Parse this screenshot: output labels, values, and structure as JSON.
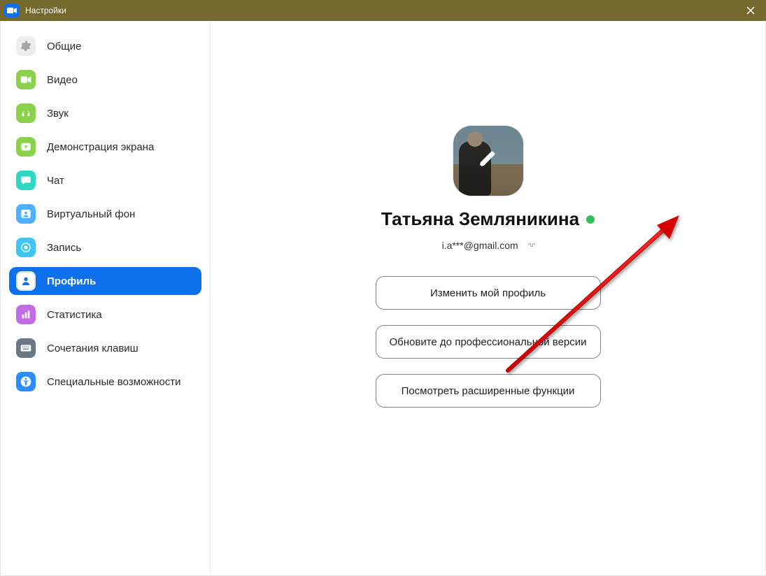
{
  "window": {
    "title": "Настройки"
  },
  "sidebar": {
    "items": [
      {
        "label": "Общие",
        "icon": "gear"
      },
      {
        "label": "Видео",
        "icon": "video"
      },
      {
        "label": "Звук",
        "icon": "headphones"
      },
      {
        "label": "Демонстрация экрана",
        "icon": "screenshare"
      },
      {
        "label": "Чат",
        "icon": "chat"
      },
      {
        "label": "Виртуальный фон",
        "icon": "virtualbg"
      },
      {
        "label": "Запись",
        "icon": "record"
      },
      {
        "label": "Профиль",
        "icon": "profile",
        "active": true
      },
      {
        "label": "Статистика",
        "icon": "stats"
      },
      {
        "label": "Сочетания клавиш",
        "icon": "keyboard"
      },
      {
        "label": "Специальные возможности",
        "icon": "accessibility"
      }
    ]
  },
  "profile": {
    "display_name": "Татьяна Земляникина",
    "status": "online",
    "email": "i.a***@gmail.com",
    "buttons": {
      "edit": "Изменить мой профиль",
      "upgrade": "Обновите до профессиональной версии",
      "advanced": "Посмотреть расширенные функции"
    }
  },
  "colors": {
    "accent": "#0e71eb",
    "status_online": "#36c05c"
  }
}
